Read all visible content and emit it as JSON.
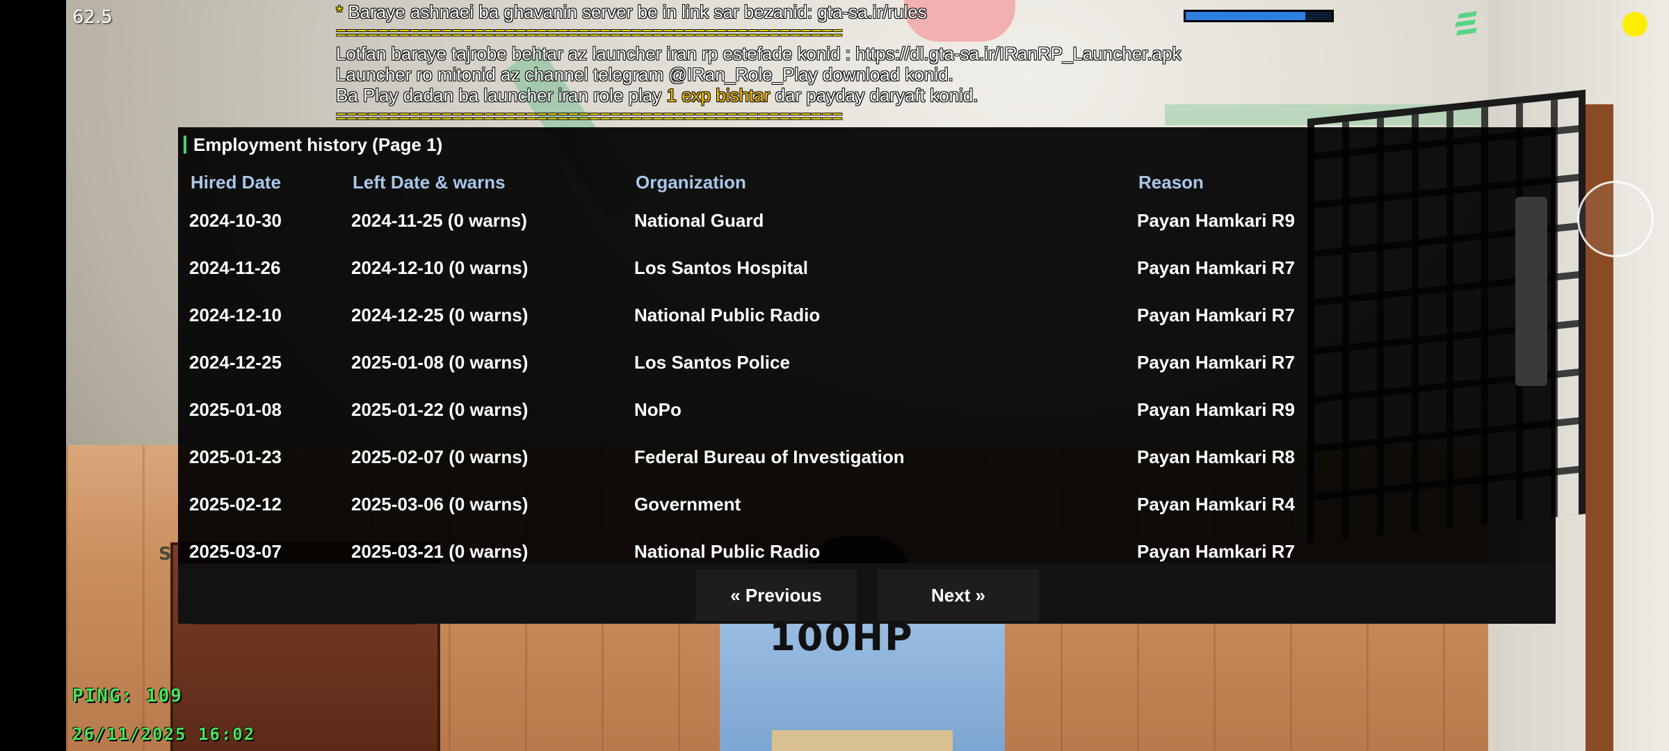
{
  "hud": {
    "fps": "62.5",
    "ping": "PING: 109",
    "datetime": "26/11/2025 16:02",
    "health_percent": 82,
    "player_hp": "100HP",
    "left_label": "S"
  },
  "chat": [
    {
      "prefix": "* ",
      "text": "Baraye ashnaei ba ghavanin server be in link sar bezanid: gta-sa.ir/rules"
    },
    {
      "separator": "================================================"
    },
    {
      "text": "Lotfan baraye tajrobe behtar az launcher iran rp estefade konid : https://dl.gta-sa.ir/IRanRP_Launcher.apk"
    },
    {
      "text": "Launcher ro mitonid az channel telegram @IRan_Role_Play download konid."
    },
    {
      "before": "Ba Play dadan ba launcher iran role play ",
      "highlight": "1 exp bishtar",
      "after": " dar payday daryaft konid."
    },
    {
      "separator": "================================================"
    }
  ],
  "dialog": {
    "title": "Employment history (Page 1)",
    "columns": [
      "Hired Date",
      "Left Date & warns",
      "Organization",
      "Reason"
    ],
    "rows": [
      [
        "2024-10-30",
        "2024-11-25 (0 warns)",
        "National Guard",
        "Payan Hamkari R9"
      ],
      [
        "2024-11-26",
        "2024-12-10 (0 warns)",
        "Los Santos Hospital",
        "Payan Hamkari R7"
      ],
      [
        "2024-12-10",
        "2024-12-25 (0 warns)",
        "National Public Radio",
        "Payan Hamkari R7"
      ],
      [
        "2024-12-25",
        "2025-01-08 (0 warns)",
        "Los Santos Police",
        "Payan Hamkari R7"
      ],
      [
        "2025-01-08",
        "2025-01-22 (0 warns)",
        "NoPo",
        "Payan Hamkari R9"
      ],
      [
        "2025-01-23",
        "2025-02-07 (0 warns)",
        "Federal Bureau of Investigation",
        "Payan Hamkari R8"
      ],
      [
        "2025-02-12",
        "2025-03-06 (0 warns)",
        "Government",
        "Payan Hamkari R4"
      ],
      [
        "2025-03-07",
        "2025-03-21 (0 warns)",
        "National Public Radio",
        "Payan Hamkari R7"
      ]
    ],
    "prev_label": "« Previous",
    "next_label": "Next »"
  },
  "colors": {
    "header_text": "#a9c7ea",
    "title_accent": "#3fd47a",
    "hud_green": "#49e35b",
    "chat_highlight": "#ffc107",
    "health_fill": "#2f7fe0"
  }
}
